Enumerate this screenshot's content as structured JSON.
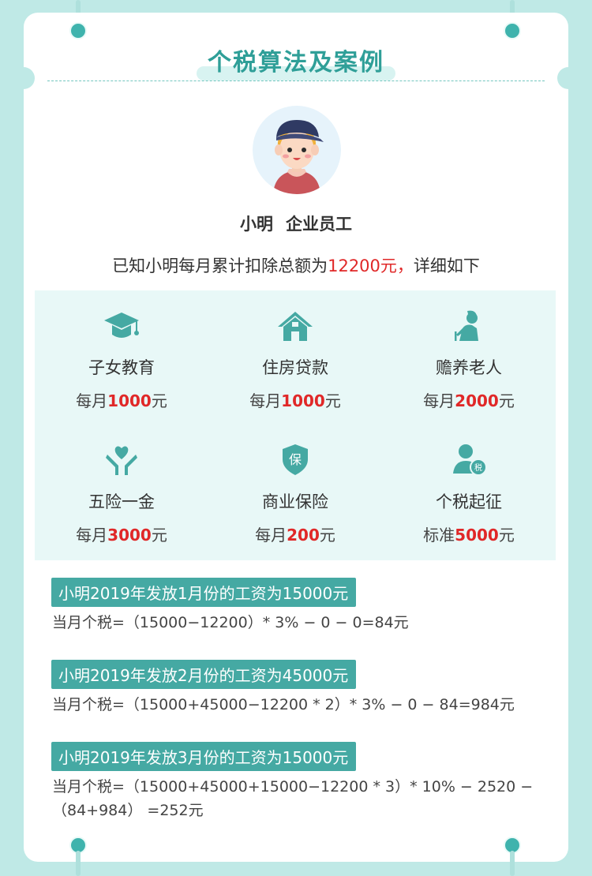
{
  "title": "个税算法及案例",
  "person": {
    "name": "小明",
    "role": "企业员工"
  },
  "summary": {
    "prefix": "已知小明每月累计扣除总额为",
    "highlight": "12200元，",
    "suffix": "详细如下"
  },
  "deductions": [
    {
      "icon": "graduation-cap-icon",
      "label": "子女教育",
      "prefix": "每月",
      "value": "1000",
      "unit": "元"
    },
    {
      "icon": "house-icon",
      "label": "住房贷款",
      "prefix": "每月",
      "value": "1000",
      "unit": "元"
    },
    {
      "icon": "elderly-person-icon",
      "label": "赡养老人",
      "prefix": "每月",
      "value": "2000",
      "unit": "元"
    },
    {
      "icon": "heart-hands-icon",
      "label": "五险一金",
      "prefix": "每月",
      "value": "3000",
      "unit": "元"
    },
    {
      "icon": "insurance-shield-icon",
      "label": "商业保险",
      "prefix": "每月",
      "value": "200",
      "unit": "元"
    },
    {
      "icon": "tax-person-icon",
      "label": "个税起征",
      "prefix": "标准",
      "value": "5000",
      "unit": "元"
    }
  ],
  "icon_glyphs": {
    "shield": "保",
    "tax": "税"
  },
  "cases": [
    {
      "title": "小明2019年发放1月份的工资为15000元",
      "formula": "当月个税=（15000−12200）* 3% − 0 − 0=84元"
    },
    {
      "title": "小明2019年发放2月份的工资为45000元",
      "formula": "当月个税=（15000+45000−12200 * 2）* 3% − 0 − 84=984元"
    },
    {
      "title": "小明2019年发放3月份的工资为15000元",
      "formula": "当月个税=（15000+45000+15000−12200 * 3）* 10% − 2520 − （84+984） =252元"
    }
  ],
  "colors": {
    "teal": "#45a9a3",
    "accent_red": "#e02828",
    "background": "#bfe9e6"
  }
}
